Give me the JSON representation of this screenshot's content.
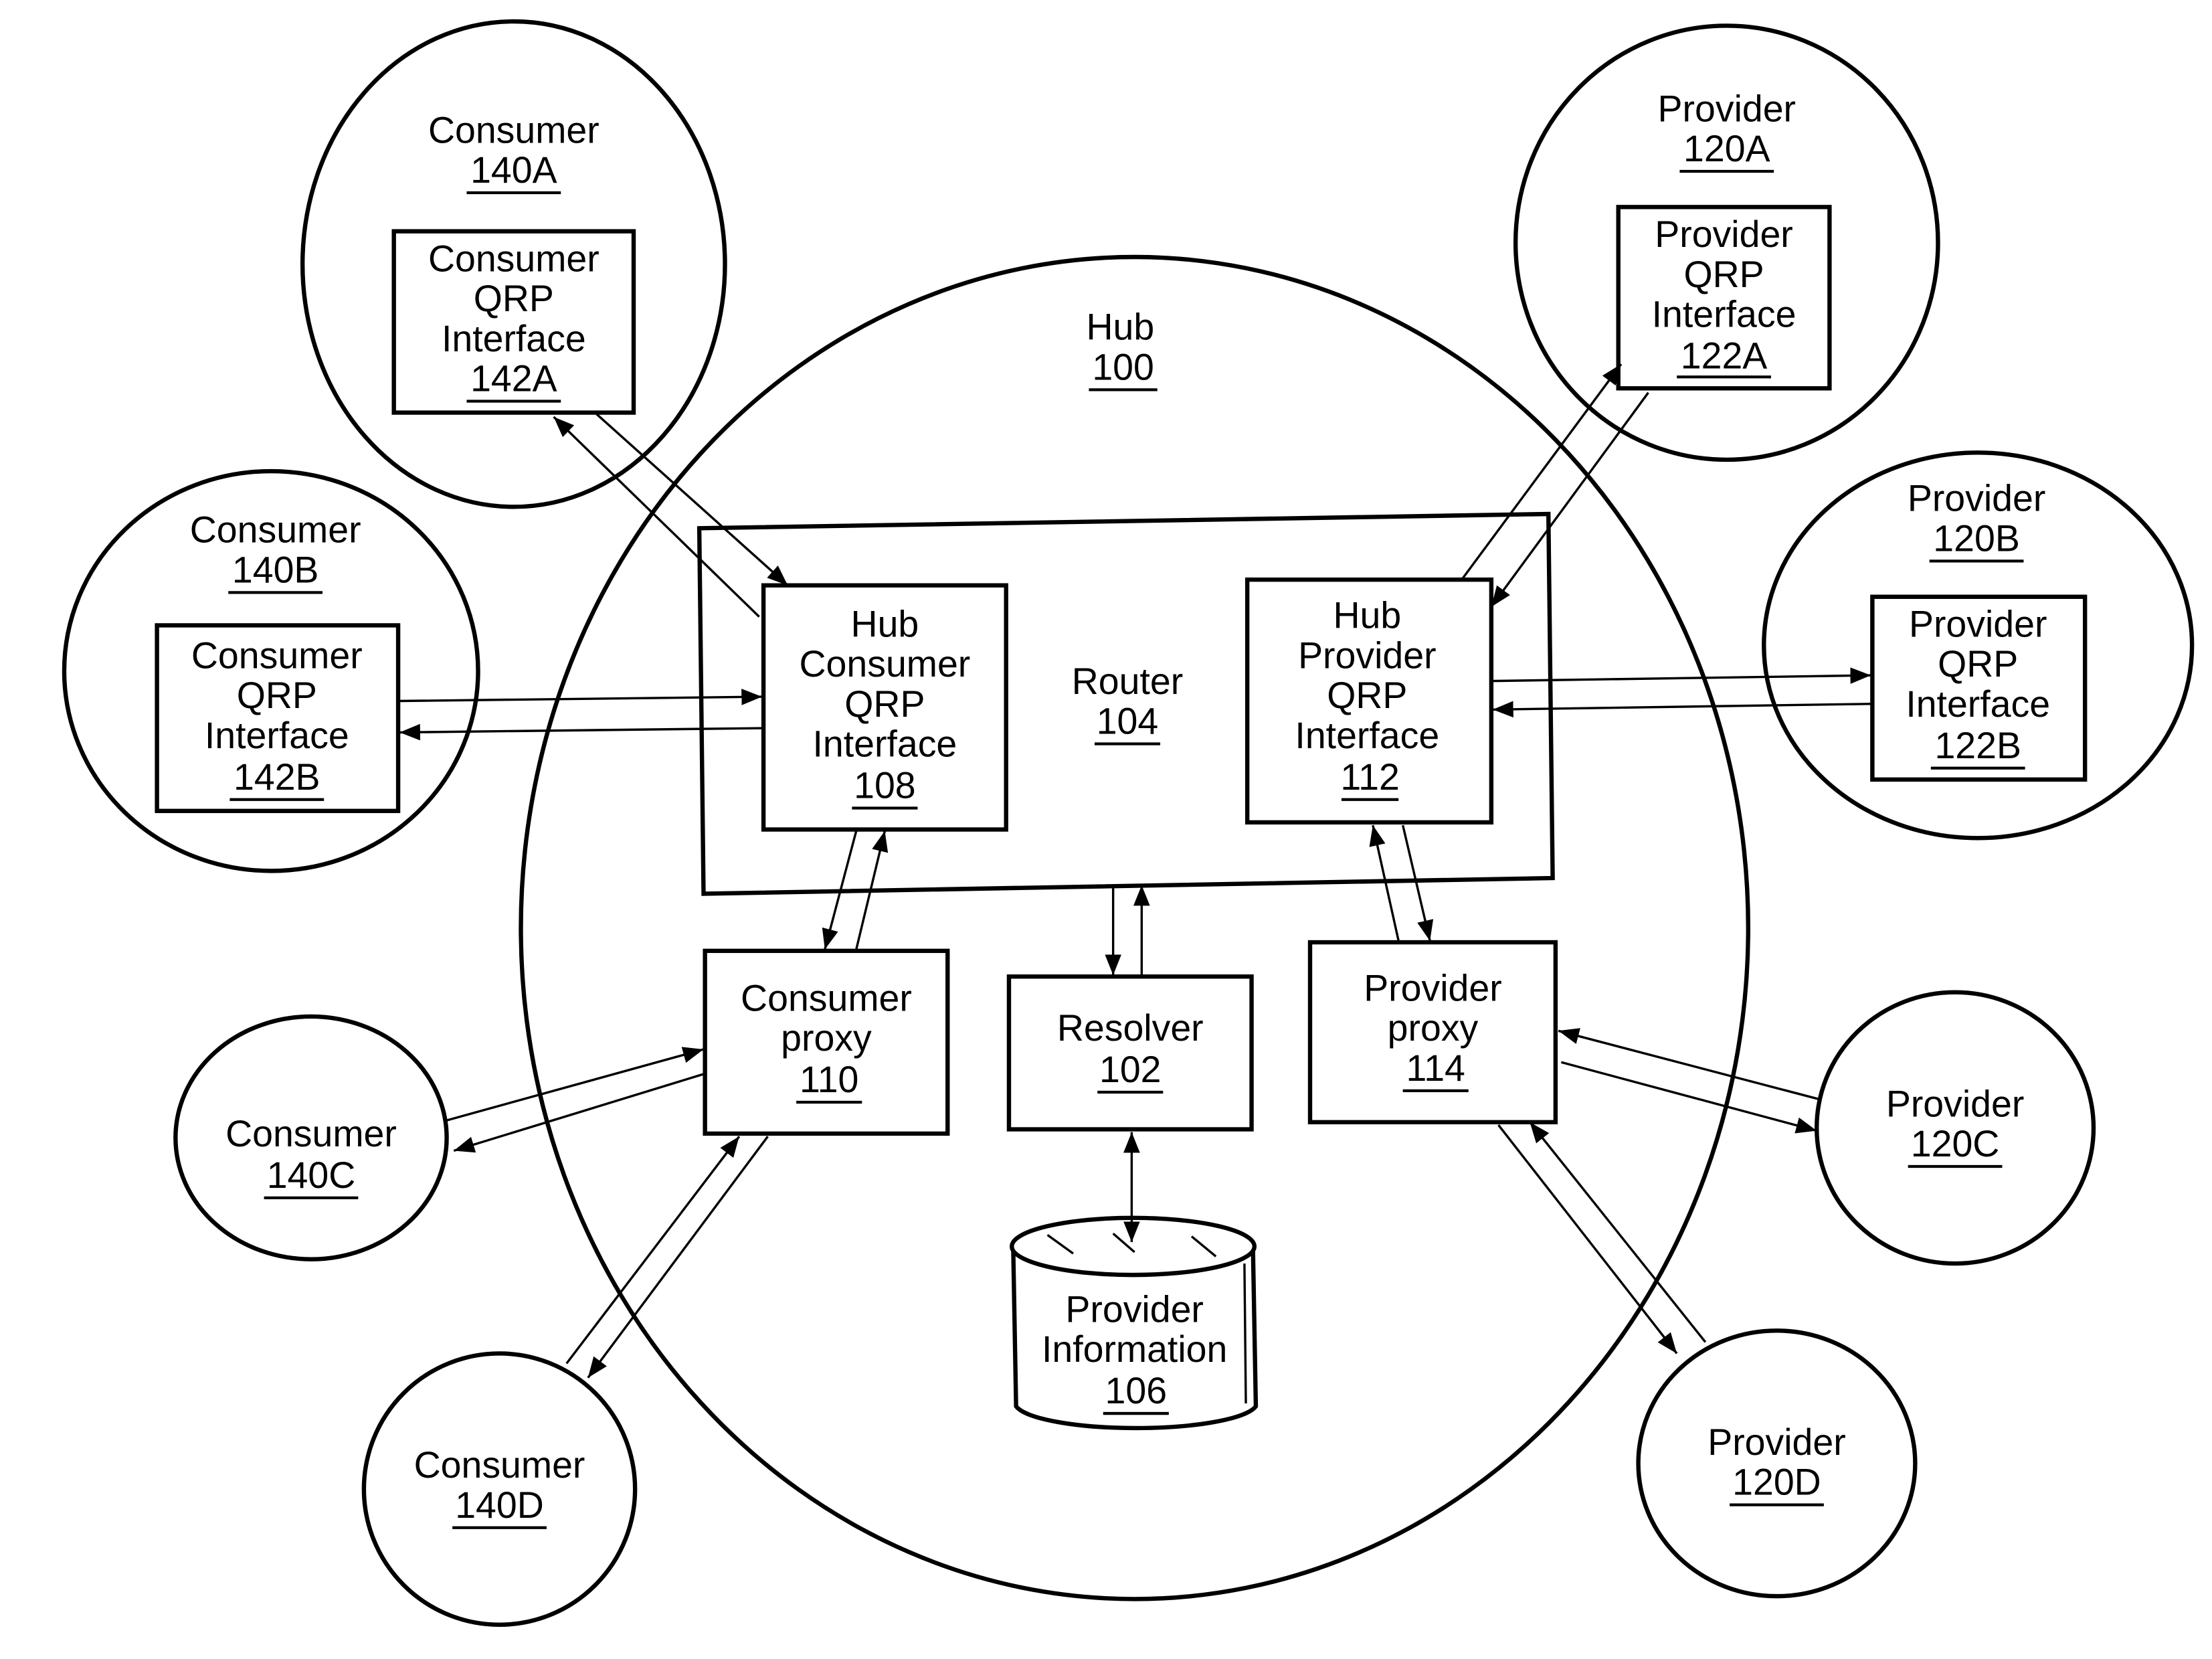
{
  "hub": {
    "title": "Hub",
    "ref": "100"
  },
  "router": {
    "title": "Router",
    "ref": "104"
  },
  "hub_consumer_iface": {
    "lines": [
      "Hub",
      "Consumer",
      "QRP",
      "Interface"
    ],
    "ref": "108"
  },
  "hub_provider_iface": {
    "lines": [
      "Hub",
      "Provider",
      "QRP",
      "Interface"
    ],
    "ref": "112"
  },
  "consumer_proxy": {
    "lines": [
      "Consumer",
      "proxy"
    ],
    "ref": "110"
  },
  "resolver": {
    "lines": [
      "Resolver"
    ],
    "ref": "102"
  },
  "provider_proxy": {
    "lines": [
      "Provider",
      "proxy"
    ],
    "ref": "114"
  },
  "provider_info": {
    "lines": [
      "Provider",
      "Information"
    ],
    "ref": "106"
  },
  "consumers": [
    {
      "title": "Consumer",
      "ref": "140A",
      "iface": {
        "lines": [
          "Consumer",
          "QRP",
          "Interface"
        ],
        "ref": "142A"
      }
    },
    {
      "title": "Consumer",
      "ref": "140B",
      "iface": {
        "lines": [
          "Consumer",
          "QRP",
          "Interface"
        ],
        "ref": "142B"
      }
    },
    {
      "title": "Consumer",
      "ref": "140C"
    },
    {
      "title": "Consumer",
      "ref": "140D"
    }
  ],
  "providers": [
    {
      "title": "Provider",
      "ref": "120A",
      "iface": {
        "lines": [
          "Provider",
          "QRP",
          "Interface"
        ],
        "ref": "122A"
      }
    },
    {
      "title": "Provider",
      "ref": "120B",
      "iface": {
        "lines": [
          "Provider",
          "QRP",
          "Interface"
        ],
        "ref": "122B"
      }
    },
    {
      "title": "Provider",
      "ref": "120C"
    },
    {
      "title": "Provider",
      "ref": "120D"
    }
  ]
}
